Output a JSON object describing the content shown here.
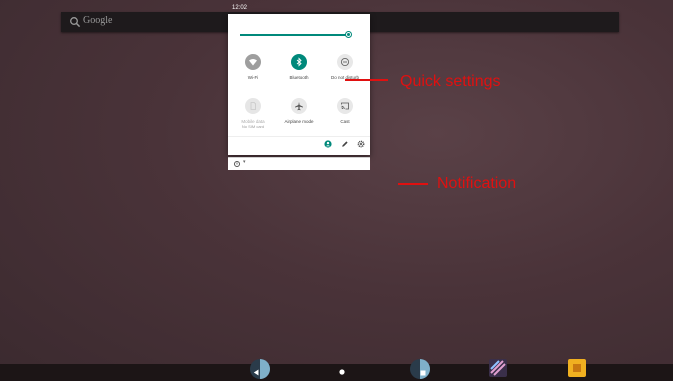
{
  "status_bar": {
    "time": "12:02"
  },
  "search": {
    "placeholder": "Google"
  },
  "quick_settings": {
    "tiles": [
      {
        "label": "Wi-Fi",
        "sub": "",
        "icon": "wifi-icon",
        "state": "off"
      },
      {
        "label": "Bluetooth",
        "sub": "",
        "icon": "bluetooth-icon",
        "state": "on"
      },
      {
        "label": "Do not disturb",
        "sub": "",
        "icon": "do-not-disturb-icon",
        "state": "off"
      },
      {
        "label": "Mobile data",
        "sub": "No SIM card",
        "icon": "sim-card-icon",
        "state": "disabled"
      },
      {
        "label": "Airplane mode",
        "sub": "",
        "icon": "airplane-icon",
        "state": "off"
      },
      {
        "label": "Cast",
        "sub": "",
        "icon": "cast-icon",
        "state": "off"
      }
    ],
    "brightness_level": 0.95,
    "footer_icons": [
      "user-icon",
      "edit-icon",
      "settings-icon"
    ]
  },
  "annotations": {
    "quick_settings": "Quick settings",
    "notification": "Notification"
  },
  "colors": {
    "accent": "#00897b",
    "callout": "#e01010",
    "tile_off": "#9e9e9e",
    "tile_disabled": "#e6e6e6"
  }
}
